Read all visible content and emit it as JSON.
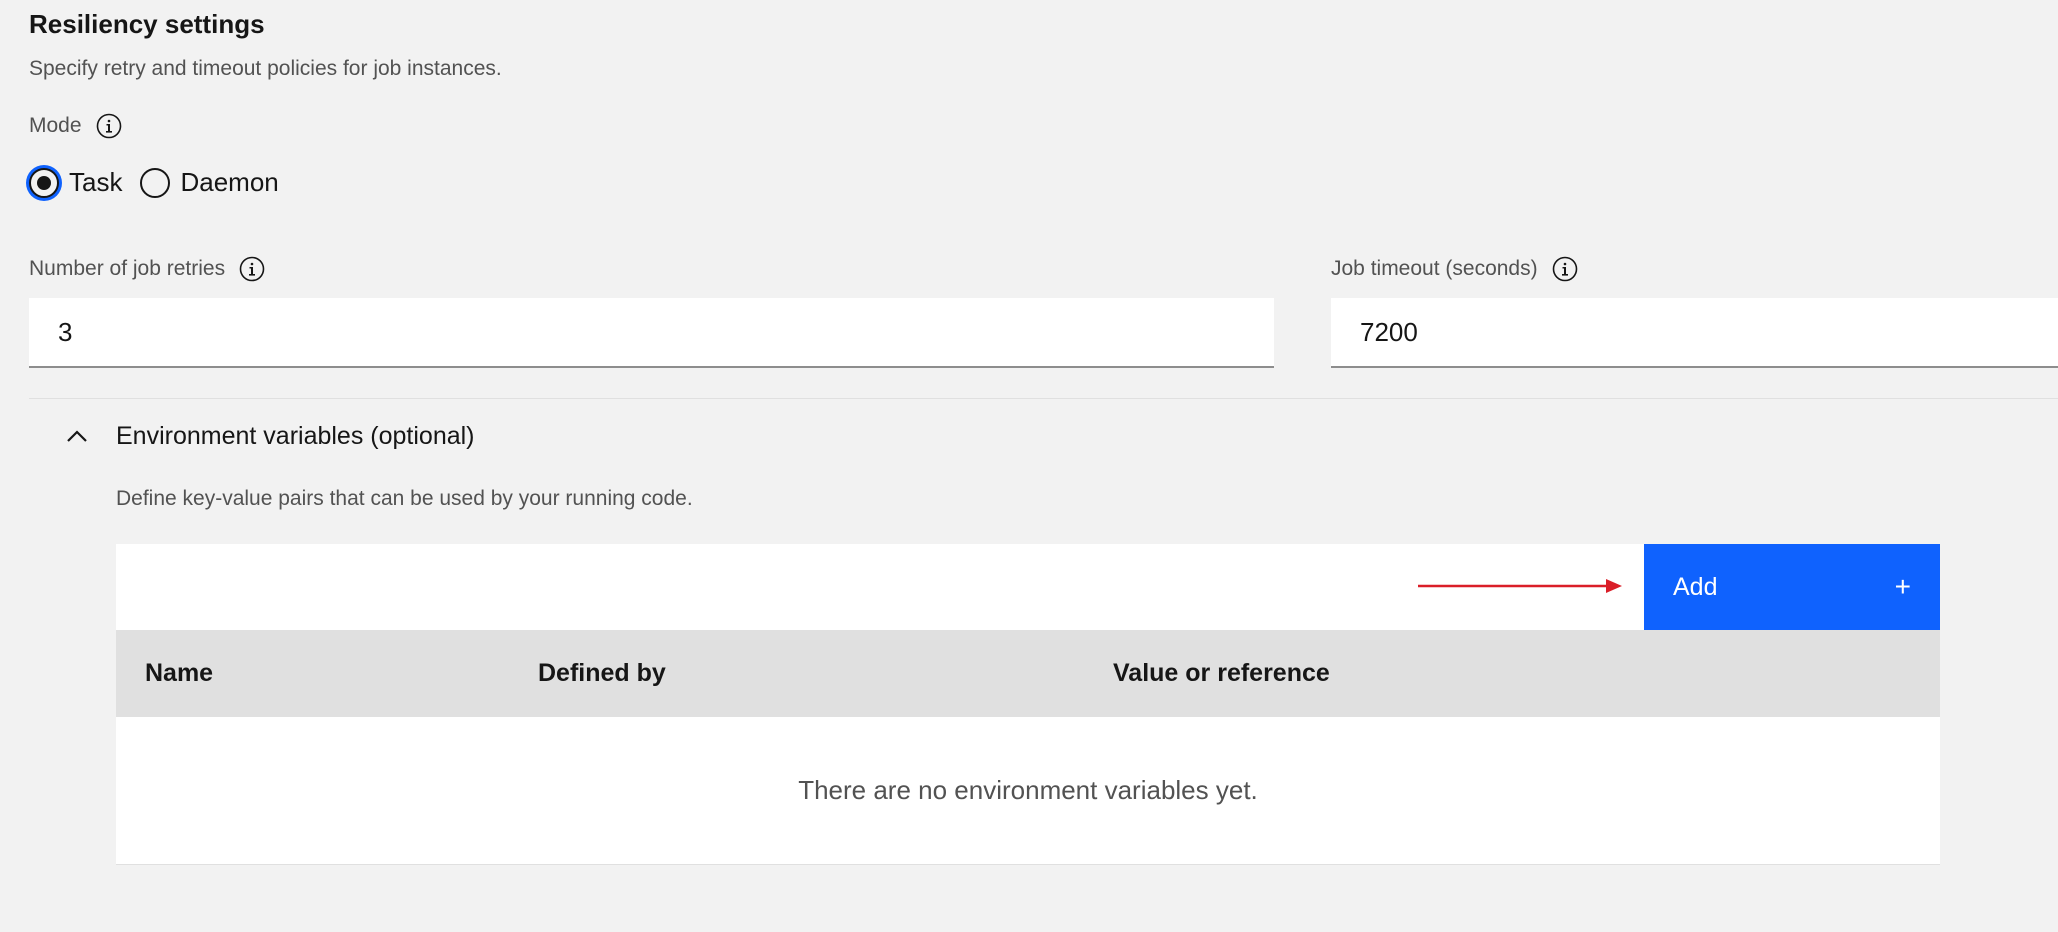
{
  "resiliency": {
    "title": "Resiliency settings",
    "description": "Specify retry and timeout policies for job instances."
  },
  "mode": {
    "label": "Mode",
    "options": [
      {
        "label": "Task",
        "selected": true
      },
      {
        "label": "Daemon",
        "selected": false
      }
    ]
  },
  "retries": {
    "label": "Number of job retries",
    "value": "3"
  },
  "timeout": {
    "label": "Job timeout (seconds)",
    "value": "7200"
  },
  "env_vars": {
    "title": "Environment variables (optional)",
    "description": "Define key-value pairs that can be used by your running code.",
    "add_label": "Add",
    "add_icon": "+",
    "columns": [
      "Name",
      "Defined by",
      "Value or reference"
    ],
    "empty_message": "There are no environment variables yet."
  },
  "colors": {
    "primary": "#0f62fe",
    "annotation_arrow": "#da1e28",
    "background": "#f2f2f2"
  }
}
